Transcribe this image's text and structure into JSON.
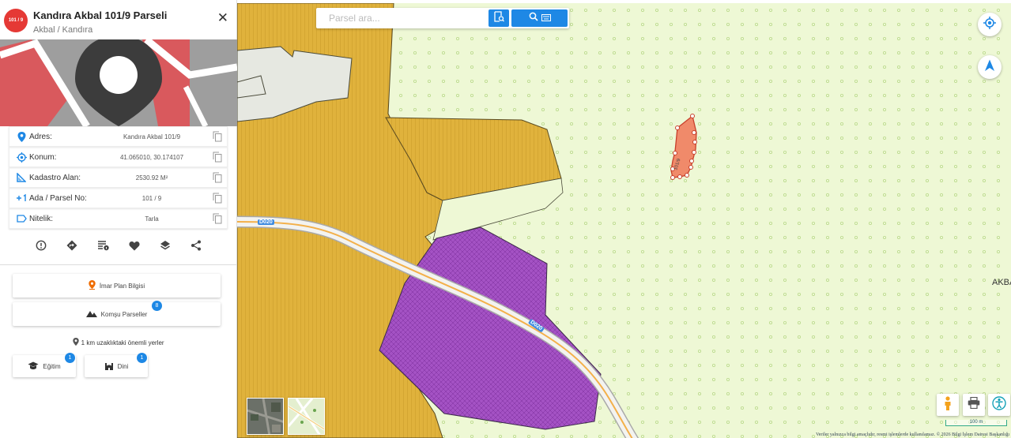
{
  "parcel": {
    "badge": "101 / 9",
    "title": "Kandıra Akbal 101/9 Parseli",
    "subtitle": "Akbal / Kandıra",
    "close_icon": "close-icon"
  },
  "info": [
    {
      "icon": "location-pin-icon",
      "label": "Adres:",
      "value": "Kandıra Akbal 101/9"
    },
    {
      "icon": "crosshair-icon",
      "label": "Konum:",
      "value": "41.065010, 30.174107"
    },
    {
      "icon": "area-ruler-icon",
      "label": "Kadastro Alan:",
      "value": "2530.92 M²"
    },
    {
      "icon": "plus-one-icon",
      "label": "Ada / Parsel No:",
      "value": "101 / 9"
    },
    {
      "icon": "tag-icon",
      "label": "Nitelik:",
      "value": "Tarla"
    }
  ],
  "actions": [
    "info-icon",
    "directions-icon",
    "document-info-icon",
    "favorite-icon",
    "layers-icon",
    "share-icon"
  ],
  "buttons": {
    "imar": "İmar Plan Bilgisi",
    "komsu": "Komşu Parseller",
    "komsu_count": "8",
    "nearby_label": "1 km uzaklıktaki önemli yerler",
    "egitim": "Eğitim",
    "egitim_count": "1",
    "dini": "Dini",
    "dini_count": "1"
  },
  "map": {
    "search_placeholder": "Parsel ara...",
    "place_label": "AKBA",
    "road_label_1": "D020",
    "road_label_2": "D020",
    "parcel_label": "101/9",
    "scale_label": "100 m",
    "attribution": "Veriler yalnızca bilgi amaçlıdır, resmi işlemlerde kullanılamaz. © 2026 Bilgi İşlem Dairesi Başkanlığı"
  },
  "colors": {
    "accent": "#1e88e5",
    "badge": "#e53935",
    "agri": "#eef8d5",
    "zone_orange": "#e0b23c",
    "zone_purple": "#a04fc0",
    "parcel": "#f08a6a"
  }
}
